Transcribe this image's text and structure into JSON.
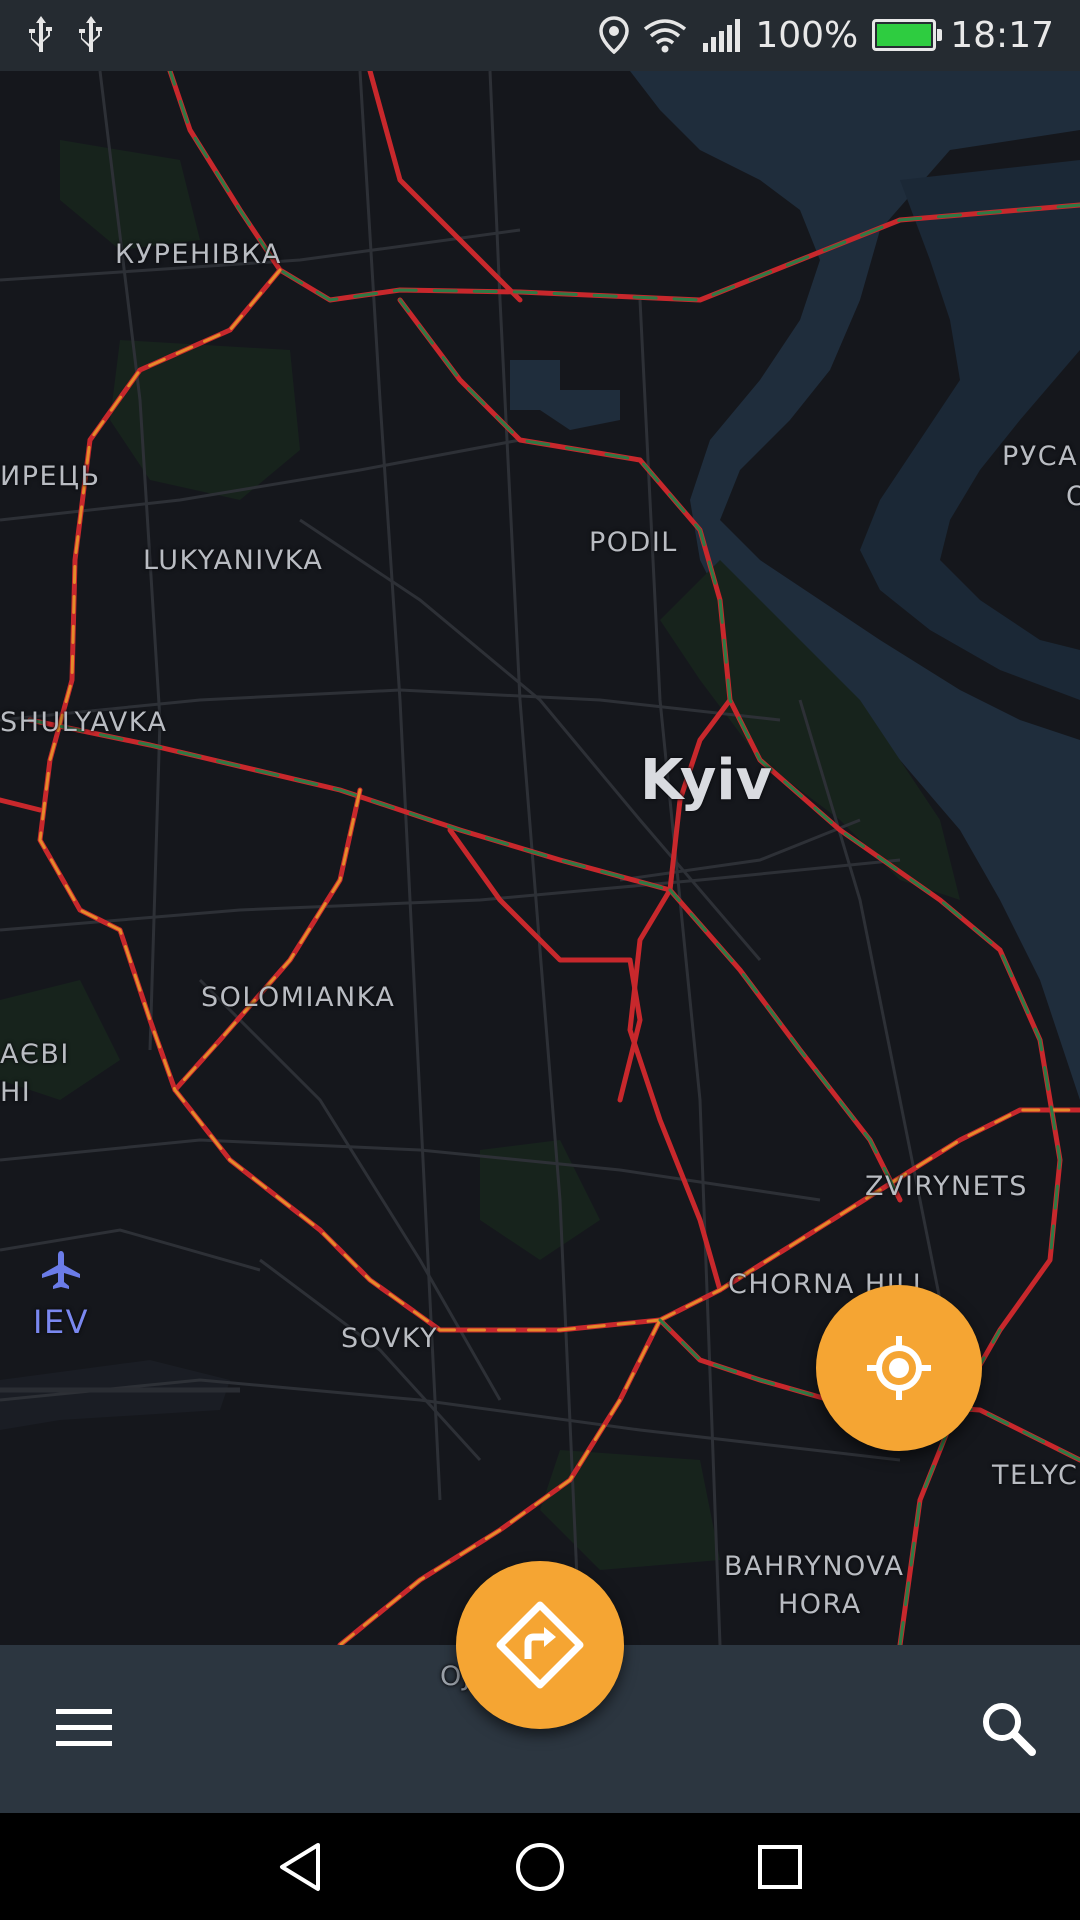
{
  "status_bar": {
    "left_icons": [
      "usb-icon",
      "usb-icon"
    ],
    "right_icons": [
      "location-icon",
      "wifi-icon",
      "signal-icon"
    ],
    "battery_percent": "100%",
    "battery_level": 1.0,
    "time": "18:17"
  },
  "map": {
    "city_label": "Kyiv",
    "places": {
      "kurenivka": "КУРЕНІВКА",
      "syrets": "ИРЕЦЬ",
      "lukyanivka": "LUKYANIVKA",
      "podil": "PODIL",
      "rusanivka_a": "РУСА",
      "rusanivka_b": "О",
      "shulyavka": "SHULYAVKA",
      "solomianka": "SOLOMIANKA",
      "vidradnyi_a": "АЄВІ",
      "vidradnyi_b": "НІ",
      "iev": "IEV",
      "sovky": "SOVKY",
      "zvirynets": "ZVIRYNETS",
      "chorna_hill": "CHORNA HILL",
      "telychka": "TELYC",
      "bahrynova_a": "BAHRYNOVA",
      "bahrynova_b": "HORA",
      "partial_bottom": "ОJ"
    },
    "airport_icon": "airplane-icon",
    "colors": {
      "traffic_red": "#c8282c",
      "traffic_orange": "#e58a2a",
      "traffic_green": "#2f7a44",
      "water": "#1f2e3e",
      "accent": "#f5a533"
    }
  },
  "buttons": {
    "locate_icon": "crosshair-icon",
    "route_icon": "route-sign-icon",
    "menu_icon": "hamburger-icon",
    "search_icon": "search-icon"
  },
  "nav": {
    "back_icon": "back-triangle-icon",
    "home_icon": "home-circle-icon",
    "recents_icon": "recents-square-icon"
  }
}
